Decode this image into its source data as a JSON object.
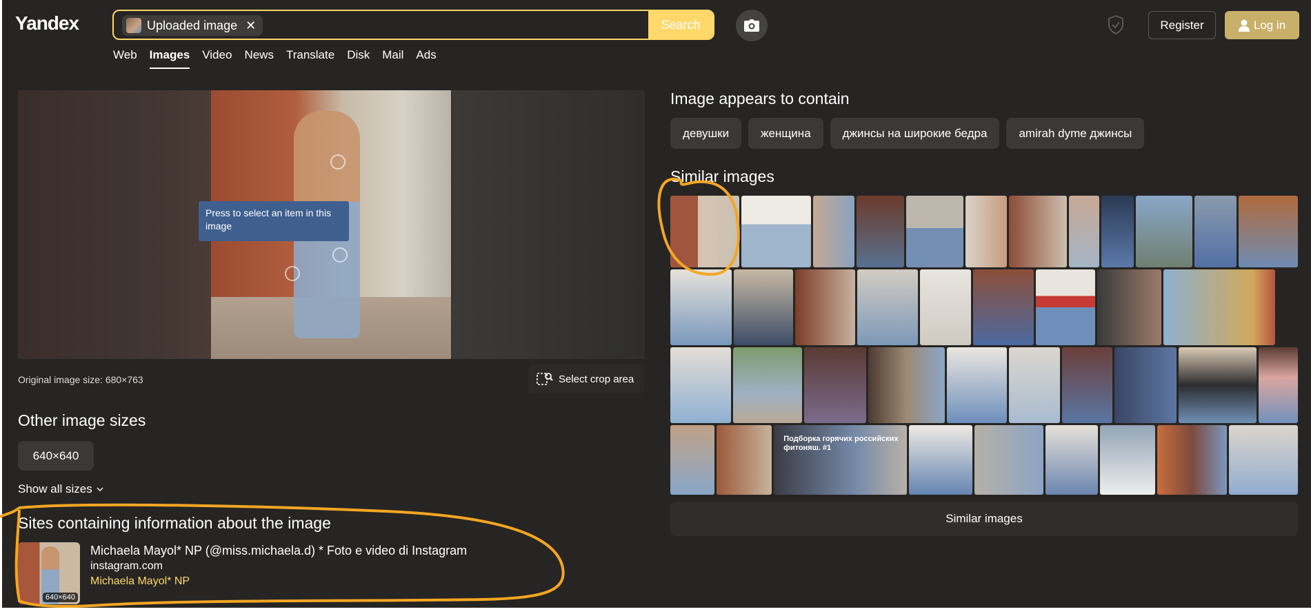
{
  "header": {
    "logo": "Yandex",
    "search": {
      "chip_label": "Uploaded image",
      "chip_close": "✕",
      "button_label": "Search"
    },
    "register_label": "Register",
    "login_label": "Log in"
  },
  "tabs": [
    {
      "label": "Web",
      "active": false
    },
    {
      "label": "Images",
      "active": true
    },
    {
      "label": "Video",
      "active": false
    },
    {
      "label": "News",
      "active": false
    },
    {
      "label": "Translate",
      "active": false
    },
    {
      "label": "Disk",
      "active": false
    },
    {
      "label": "Mail",
      "active": false
    },
    {
      "label": "Ads",
      "active": false
    }
  ],
  "preview": {
    "tooltip": "Press to select an item in this image",
    "original_size": "Original image size: 680×763",
    "crop_label": "Select crop area"
  },
  "other_sizes": {
    "heading": "Other image sizes",
    "size": "640×640",
    "show_all": "Show all sizes"
  },
  "sites": {
    "heading": "Sites containing information about the image",
    "item": {
      "title": "Michaela Mayol* NP (@miss.michaela.d) * Foto e video di Instagram",
      "domain": "instagram.com",
      "subtitle": "Michaela Mayol* NP",
      "thumb_size": "640×640"
    }
  },
  "contains": {
    "heading": "Image appears to contain",
    "tags": [
      "девушки",
      "женщина",
      "джинсы на широкие бедра",
      "amirah dyme джинсы"
    ]
  },
  "similar": {
    "heading": "Similar images",
    "caption": "Подборка горячих российских фитоняш. #1",
    "button_label": "Similar images"
  },
  "colors": {
    "background": "#262523",
    "accent_yellow": "#fed86a",
    "login_button": "#c9b06a",
    "tooltip_blue": "#3f5f8f",
    "annotation_orange": "#f5a623"
  }
}
